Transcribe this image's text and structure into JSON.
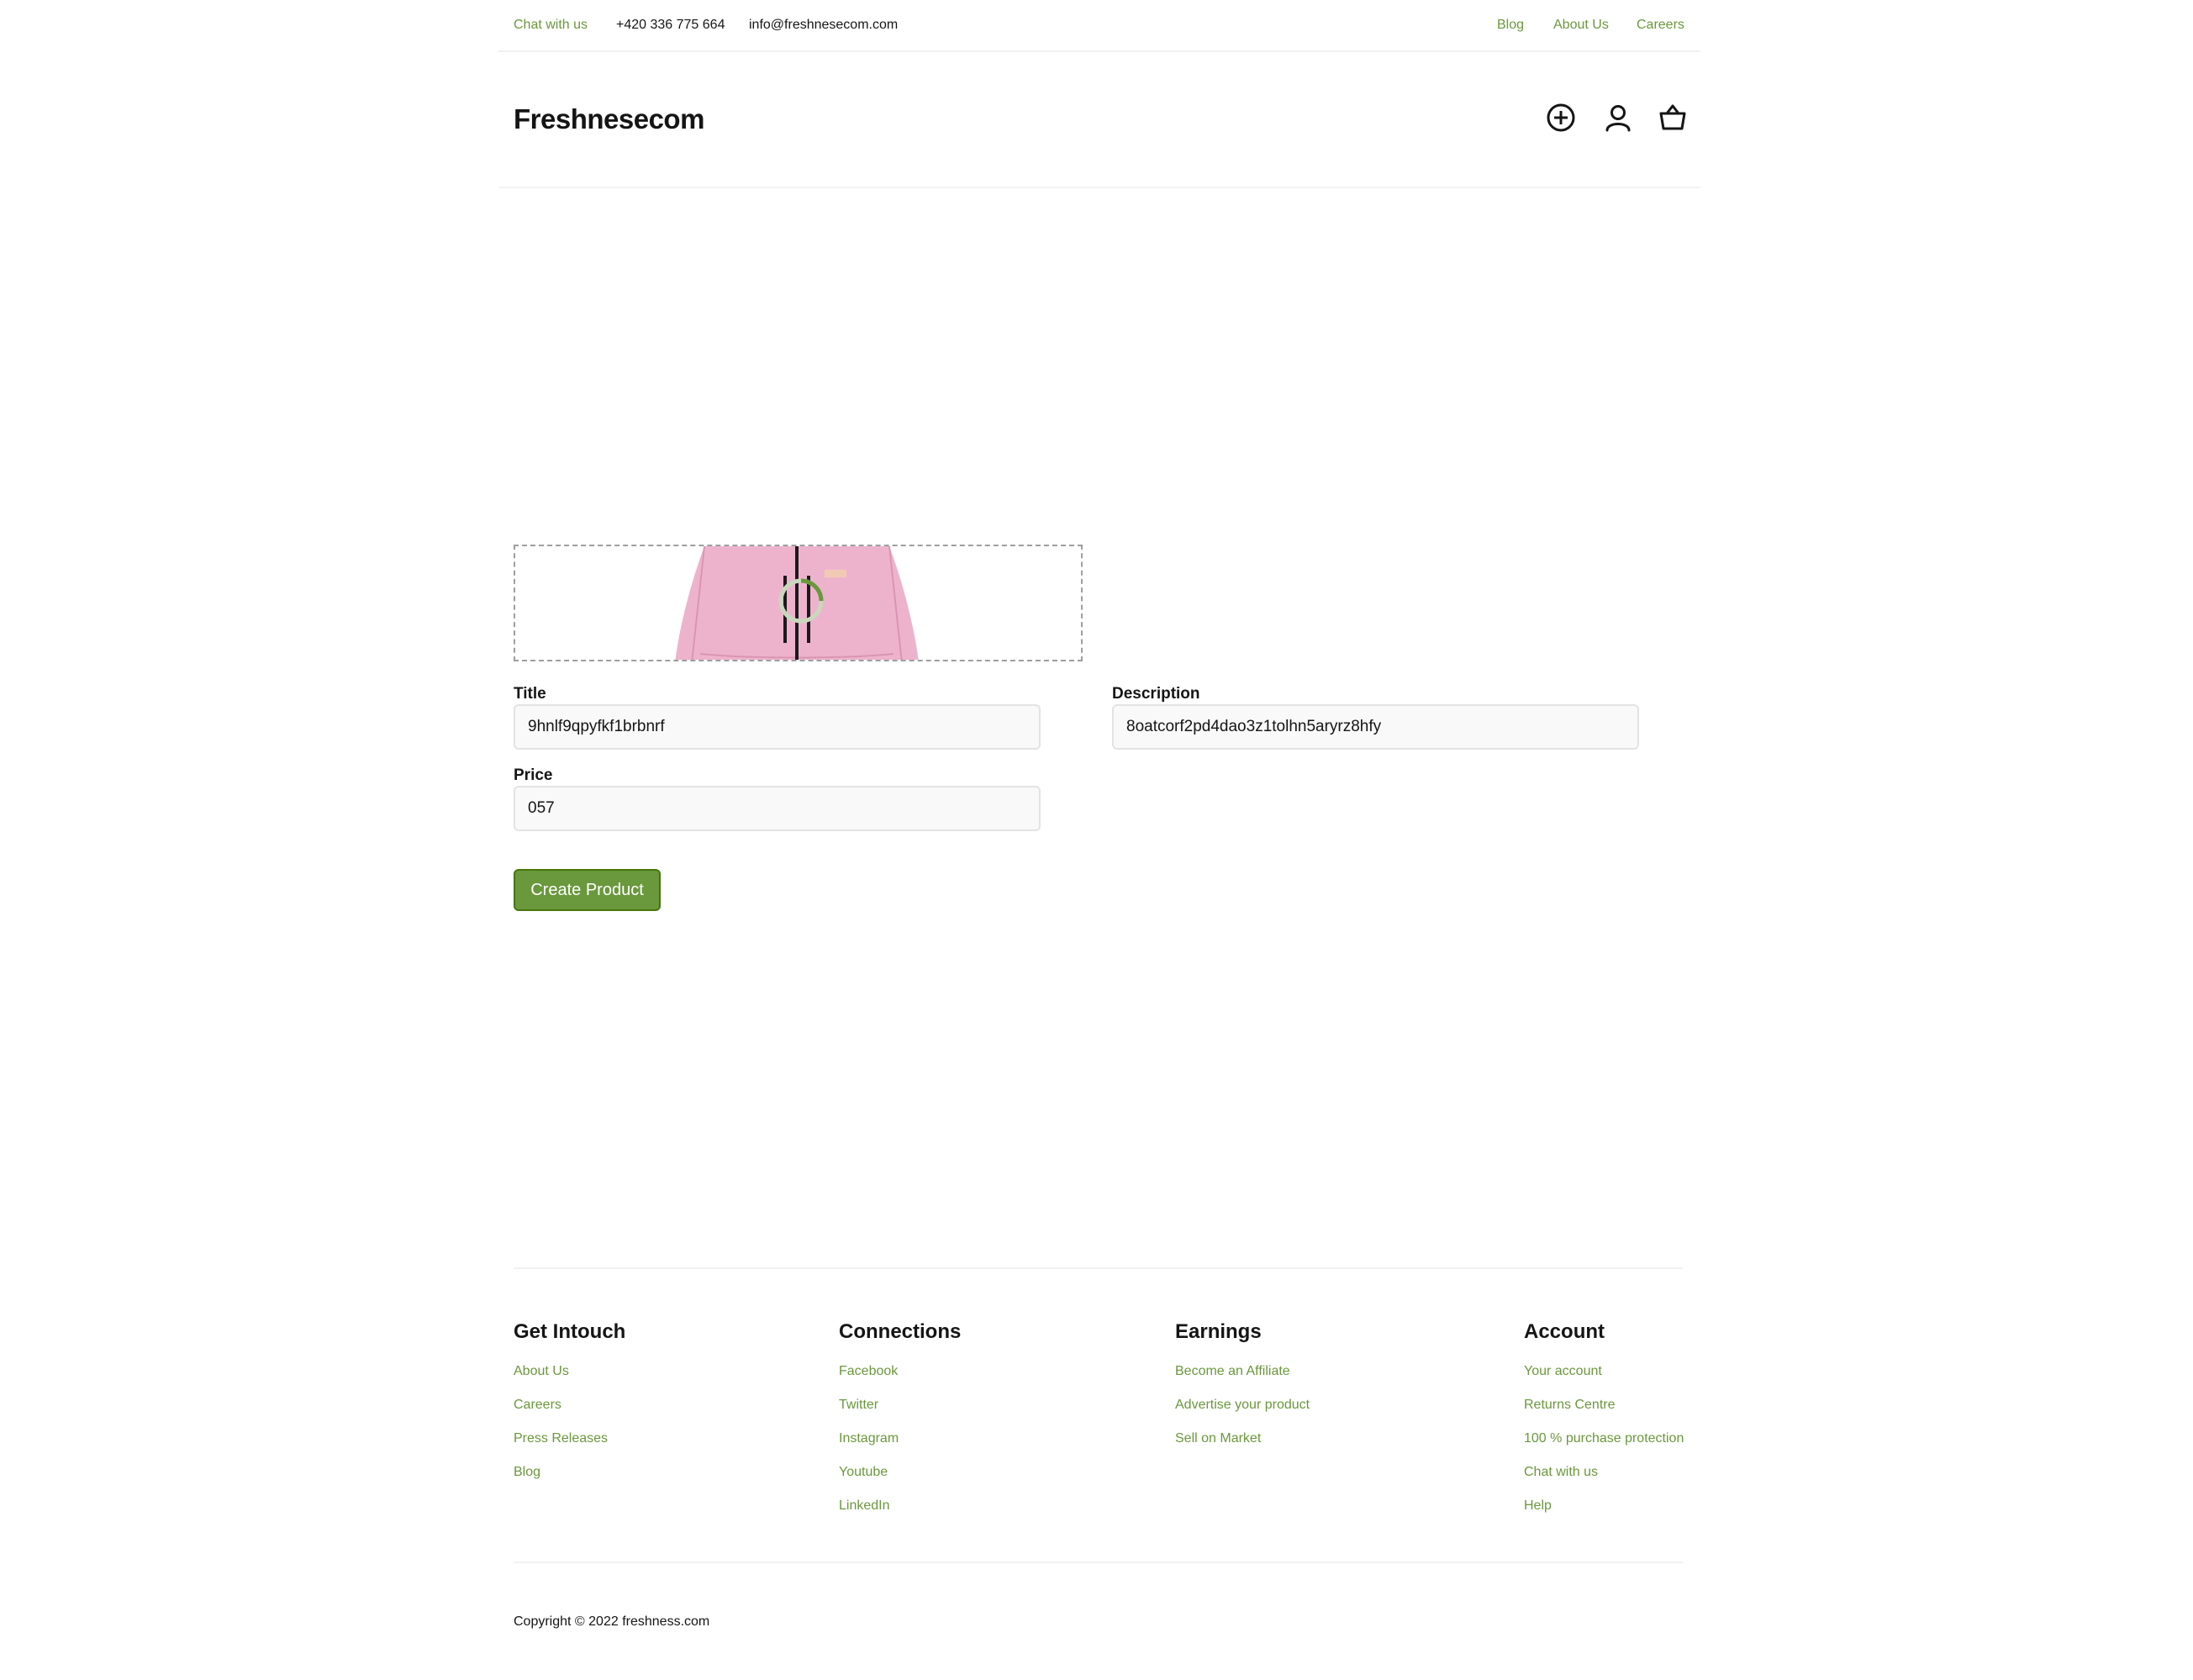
{
  "topbar": {
    "chat": "Chat with us",
    "phone": "+420 336 775 664",
    "email": "info@freshnesecom.com",
    "links": [
      "Blog",
      "About Us",
      "Careers"
    ]
  },
  "header": {
    "logo": "Freshnesecom",
    "icons": [
      "add-circle-icon",
      "user-icon",
      "basket-icon"
    ]
  },
  "form": {
    "title_label": "Title",
    "title_value": "9hnlf9qpyfkf1brbnrf",
    "description_label": "Description",
    "description_value": "8oatcorf2pd4dao3z1tolhn5aryrz8hfy",
    "price_label": "Price",
    "price_value": "057",
    "submit_label": "Create Product"
  },
  "footer": {
    "columns": [
      {
        "title": "Get Intouch",
        "links": [
          "About Us",
          "Careers",
          "Press Releases",
          "Blog"
        ]
      },
      {
        "title": "Connections",
        "links": [
          "Facebook",
          "Twitter",
          "Instagram",
          "Youtube",
          "LinkedIn"
        ]
      },
      {
        "title": "Earnings",
        "links": [
          "Become an Affiliate",
          "Advertise your product",
          "Sell on Market"
        ]
      },
      {
        "title": "Account",
        "links": [
          "Your account",
          "Returns Centre",
          "100 % purchase protection",
          "Chat with us",
          "Help"
        ]
      }
    ],
    "copyright": "Copyright © 2022 freshness.com"
  },
  "colors": {
    "accent": "#6a983c",
    "accent_border": "#46760a",
    "text": "#151515",
    "jacket": "#eeb3cc"
  }
}
